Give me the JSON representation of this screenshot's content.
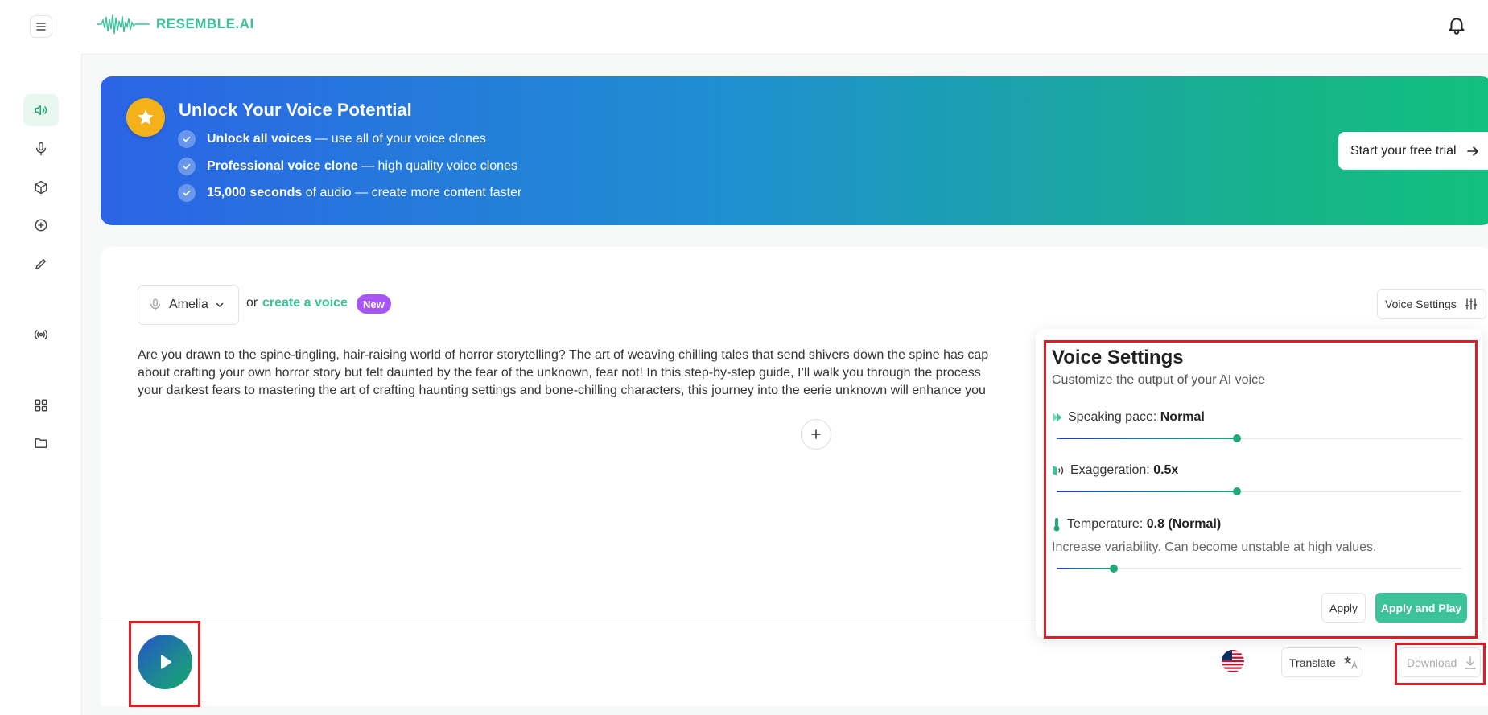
{
  "colors": {
    "brand": "#3cc39a",
    "highlight": "#e01b24",
    "badge": "#a855f7",
    "star": "#f4b11a"
  },
  "header": {
    "logo_text": "RESEMBLE.AI",
    "icons": [
      "menu-icon",
      "bell-icon"
    ]
  },
  "sidebar": {
    "items": [
      {
        "icon": "speaker-icon",
        "active": true
      },
      {
        "icon": "microphone-icon",
        "active": false
      },
      {
        "icon": "cube-icon",
        "active": false
      },
      {
        "icon": "plus-circle-icon",
        "active": false
      },
      {
        "icon": "pencil-icon",
        "active": false
      },
      {
        "icon": "broadcast-icon",
        "active": false
      },
      {
        "icon": "grid-icon",
        "active": false
      },
      {
        "icon": "folder-icon",
        "active": false
      }
    ]
  },
  "banner": {
    "title": "Unlock Your Voice Potential",
    "bullets": [
      {
        "bold": "Unlock all voices",
        "rest": " — use all of your voice clones"
      },
      {
        "bold": "Professional voice clone",
        "rest": " — high quality voice clones"
      },
      {
        "bold": "15,000 seconds",
        "rest": " of audio — create more content faster"
      }
    ],
    "cta": "Start your free trial"
  },
  "editor": {
    "voice": "Amelia",
    "or": "or",
    "create_link": "create a voice",
    "new_badge": "New",
    "voice_settings_button": "Voice Settings",
    "text_lines": [
      "Are you drawn to the spine-tingling, hair-raising world of horror storytelling? The art of weaving chilling tales that send shivers down the spine has cap",
      "about crafting your own horror story but felt daunted by the fear of the unknown, fear not! In this step-by-step guide, I’ll walk you through the process",
      "your darkest fears to mastering the art of crafting haunting settings and bone-chilling characters, this journey into the eerie unknown will enhance you"
    ]
  },
  "voice_settings": {
    "title": "Voice Settings",
    "subtitle": "Customize the output of your AI voice",
    "pace": {
      "label": "Speaking pace: ",
      "value": "Normal",
      "level": 0.445
    },
    "exaggeration": {
      "label": "Exaggeration: ",
      "value": "0.5x",
      "level": 0.445
    },
    "temperature": {
      "label": "Temperature: ",
      "value": "0.8 (Normal)",
      "level": 0.14
    },
    "hint": "Increase variability. Can become unstable at high values.",
    "apply": "Apply",
    "apply_play": "Apply and Play"
  },
  "bottom": {
    "translate": "Translate",
    "download": "Download"
  }
}
